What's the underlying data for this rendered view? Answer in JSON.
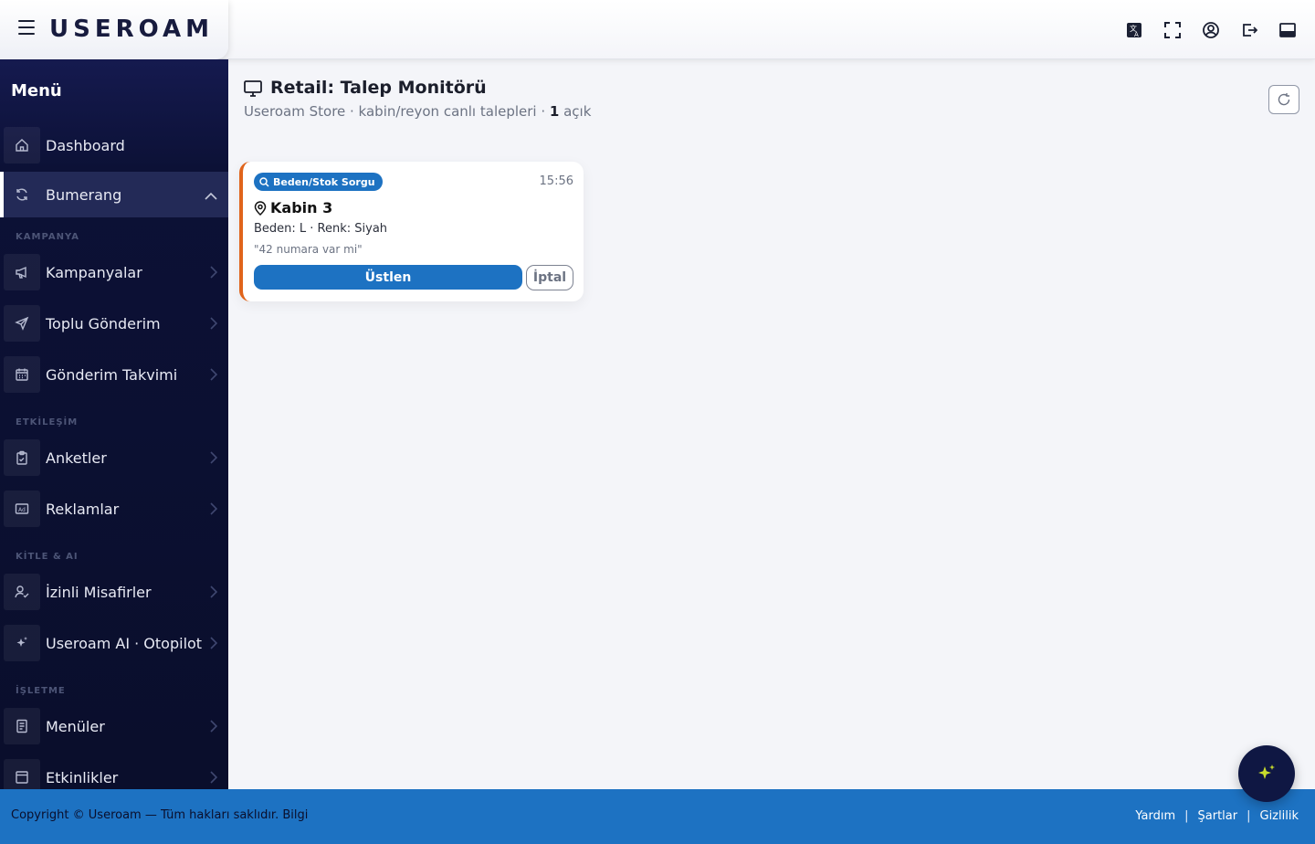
{
  "brand": {
    "logo_text": "USEROAM"
  },
  "header": {
    "tools": [
      "translate-icon",
      "fullscreen-icon",
      "user-icon",
      "logout-icon",
      "panel-icon"
    ]
  },
  "sidebar": {
    "title": "Menü",
    "items": [
      {
        "label": "Dashboard",
        "icon": "home-icon"
      },
      {
        "label": "Bumerang",
        "icon": "refresh-icon",
        "active": true
      },
      {
        "label": "Kampanyalar",
        "icon": "megaphone-icon"
      },
      {
        "label": "Toplu Gönderim",
        "icon": "send-icon"
      },
      {
        "label": "Gönderim Takvimi",
        "icon": "calendar-icon"
      },
      {
        "label": "Anketler",
        "icon": "clipboard-icon"
      },
      {
        "label": "Reklamlar",
        "icon": "ad-icon"
      },
      {
        "label": "İzinli Misafirler",
        "icon": "user-check-icon"
      },
      {
        "label": "Useroam AI · Otopilot",
        "icon": "sparkles-icon"
      },
      {
        "label": "Menüler",
        "icon": "menu-doc-icon"
      },
      {
        "label": "Etkinlikler",
        "icon": "event-icon"
      }
    ],
    "sections": [
      "KAMPANYA",
      "ETKİLEŞİM",
      "KİTLE & AI",
      "İŞLETME"
    ]
  },
  "main": {
    "title": "Retail: Talep Monitörü",
    "subtitle_prefix": "Useroam Store · kabin/reyon canlı talepleri · ",
    "open_count": "1",
    "subtitle_suffix": " açık"
  },
  "request_card": {
    "badge": "Beden/Stok Sorgu",
    "time": "15:56",
    "location": "Kabin 3",
    "detail": "Beden: L · Renk: Siyah",
    "note": "\"42 numara var mi\"",
    "claim_label": "Üstlen",
    "cancel_label": "İptal",
    "accent_color": "#e0641b"
  },
  "footer": {
    "copyright": "Copyright © Useroam — Tüm hakları saklıdır. Bilgi",
    "links": [
      "Yardım",
      "Şartlar",
      "Gizlilik"
    ],
    "color": "#1d72c2"
  },
  "colors": {
    "sidebar_bg": "#0c1136",
    "primary": "#1d72c2",
    "fab_spark": "#c8dd2c"
  }
}
